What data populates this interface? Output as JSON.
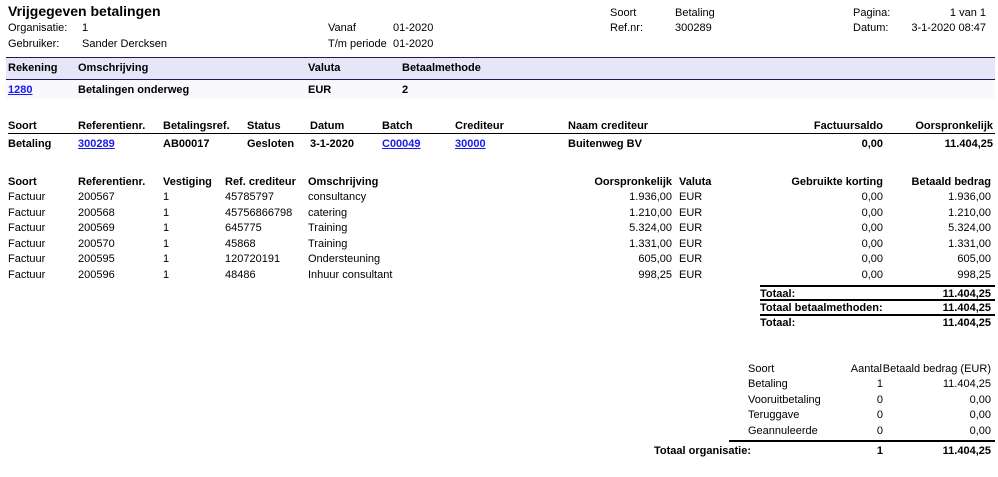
{
  "header": {
    "title": "Vrijgegeven betalingen",
    "org_label": "Organisatie:",
    "org": "1",
    "user_label": "Gebruiker:",
    "user": "Sander Dercksen",
    "from_label": "Vanaf",
    "from": "01-2020",
    "to_label": "T/m periode",
    "to": "01-2020",
    "soort_label": "Soort",
    "soort": "Betaling",
    "ref_label": "Ref.nr:",
    "ref": "300289",
    "page_label": "Pagina:",
    "page": "1 van 1",
    "date_label": "Datum:",
    "date": "3-1-2020 08:47"
  },
  "account": {
    "headers": [
      "Rekening",
      "Omschrijving",
      "Valuta",
      "Betaalmethode"
    ],
    "row": [
      "1280",
      "Betalingen onderweg",
      "EUR",
      "2"
    ]
  },
  "payment": {
    "headers": [
      "Soort",
      "Referentienr.",
      "Betalingsref.",
      "Status",
      "Datum",
      "Batch",
      "Crediteur",
      "Naam crediteur",
      "Factuursaldo",
      "Oorspronkelijk"
    ],
    "row": [
      "Betaling",
      "300289",
      "AB00017",
      "Gesloten",
      "3-1-2020",
      "C00049",
      "30000",
      "Buitenweg BV",
      "0,00",
      "11.404,25"
    ]
  },
  "invoices": {
    "headers": [
      "Soort",
      "Referentienr.",
      "Vestiging",
      "Ref. crediteur",
      "Omschrijving",
      "Oorspronkelijk",
      "Valuta",
      "Gebruikte korting",
      "Betaald bedrag"
    ],
    "rows": [
      [
        "Factuur",
        "200567",
        "1",
        "45785797",
        "consultancy",
        "1.936,00",
        "EUR",
        "0,00",
        "1.936,00"
      ],
      [
        "Factuur",
        "200568",
        "1",
        "45756866798",
        "catering",
        "1.210,00",
        "EUR",
        "0,00",
        "1.210,00"
      ],
      [
        "Factuur",
        "200569",
        "1",
        "645775",
        "Training",
        "5.324,00",
        "EUR",
        "0,00",
        "5.324,00"
      ],
      [
        "Factuur",
        "200570",
        "1",
        "45868",
        "Training",
        "1.331,00",
        "EUR",
        "0,00",
        "1.331,00"
      ],
      [
        "Factuur",
        "200595",
        "1",
        "120720191",
        "Ondersteuning",
        "605,00",
        "EUR",
        "0,00",
        "605,00"
      ],
      [
        "Factuur",
        "200596",
        "1",
        "48486",
        "Inhuur consultant",
        "998,25",
        "EUR",
        "0,00",
        "998,25"
      ]
    ]
  },
  "totals": [
    {
      "label": "Totaal:",
      "value": "11.404,25"
    },
    {
      "label": "Totaal betaalmethoden:",
      "value": "11.404,25"
    },
    {
      "label": "Totaal:",
      "value": "11.404,25"
    }
  ],
  "summary": {
    "headers": [
      "Soort",
      "Aantal",
      "Betaald bedrag (EUR)"
    ],
    "rows": [
      [
        "Betaling",
        "1",
        "11.404,25"
      ],
      [
        "Vooruitbetaling",
        "0",
        "0,00"
      ],
      [
        "Teruggave",
        "0",
        "0,00"
      ],
      [
        "Geannuleerde",
        "0",
        "0,00"
      ]
    ],
    "total": {
      "label": "Totaal organisatie:",
      "count": "1",
      "value": "11.404,25"
    }
  }
}
